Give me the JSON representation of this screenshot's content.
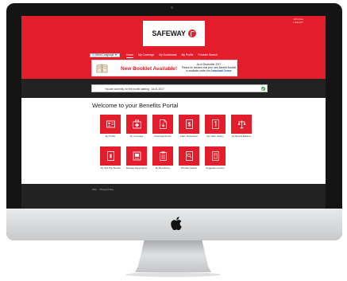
{
  "header": {
    "logo_text": "SAFEWAY",
    "user_info_line1": "John Doe",
    "user_info_line2": "LOGOUT"
  },
  "language": {
    "label": "Select Language",
    "arrow": "▼"
  },
  "nav": {
    "items": [
      "Home",
      "My Coverage",
      "My Downloads",
      "My Profile",
      "Provider Search"
    ]
  },
  "banner": {
    "headline": "New Booklet Available!",
    "line1": "As of December 2017",
    "line2": "Please be advised that your new Benefit Booklet",
    "line3_prefix": "is available under the",
    "link": "Download Centre",
    "icon": "booklet-icon"
  },
  "status": {
    "text": "You are currently, for the month starting : Jul 31 2017"
  },
  "page": {
    "title": "Welcome to your Benefits Portal"
  },
  "tiles": [
    {
      "label": "My Profile",
      "icon": "profile-card-icon"
    },
    {
      "label": "My Coverage",
      "icon": "first-aid-kit-icon"
    },
    {
      "label": "Download Forms",
      "icon": "document-download-icon"
    },
    {
      "label": "Claim Submission",
      "icon": "dollar-receipt-icon"
    },
    {
      "label": "My Claim History",
      "icon": "claim-history-icon"
    },
    {
      "label": "My Benefit Balance",
      "icon": "scale-balance-icon"
    },
    {
      "label": "My Sick Pay Benefit",
      "icon": "sick-pay-icon"
    },
    {
      "label": "Manage Dependents",
      "icon": "dependents-icon"
    },
    {
      "label": "My Beneficiary",
      "icon": "beneficiary-icon"
    },
    {
      "label": "Provider Search",
      "icon": "provider-search-icon"
    },
    {
      "label": "Suggestion Centre",
      "icon": "suggestion-icon"
    }
  ],
  "footer": {
    "links": [
      "FAQ",
      "Privacy Policy"
    ]
  },
  "colors": {
    "brand_red": "#e31d2c",
    "dark_band": "#222222"
  }
}
